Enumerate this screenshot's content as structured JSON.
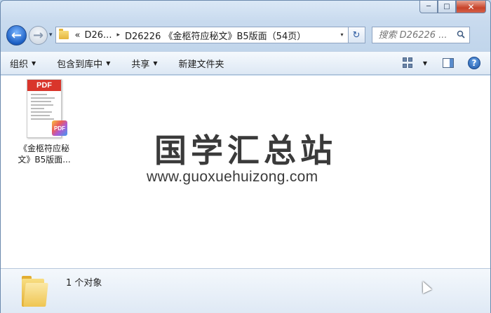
{
  "window": {
    "minimize_glyph": "─",
    "maximize_glyph": "□",
    "close_glyph": "✕"
  },
  "nav": {
    "back_glyph": "←",
    "forward_glyph": "→",
    "history_glyph": "▾",
    "overflow_glyph": "«",
    "breadcrumb": [
      "D26...",
      "D26226 《金柩符应秘文》B5版面（54页）"
    ],
    "separator_glyph": "▸",
    "dropdown_glyph": "▾",
    "refresh_glyph": "↻",
    "search_placeholder": "搜索 D26226 ..."
  },
  "toolbar": {
    "items": [
      "组织",
      "包含到库中",
      "共享",
      "新建文件夹"
    ],
    "dropdown_glyph": "▼",
    "help_glyph": "?"
  },
  "file": {
    "pdf_label": "PDF",
    "badge_label": "PDF",
    "name_line1": "《金柩符应秘",
    "name_line2": "文》B5版面..."
  },
  "watermark": {
    "title": "国学汇总站",
    "url": "www.guoxuehuizong.com"
  },
  "status": {
    "count_text": "1 个对象"
  },
  "colors": {
    "frame": "#bfd4ea",
    "pdf_red": "#d9352b",
    "accent_blue": "#1c5fc4"
  }
}
